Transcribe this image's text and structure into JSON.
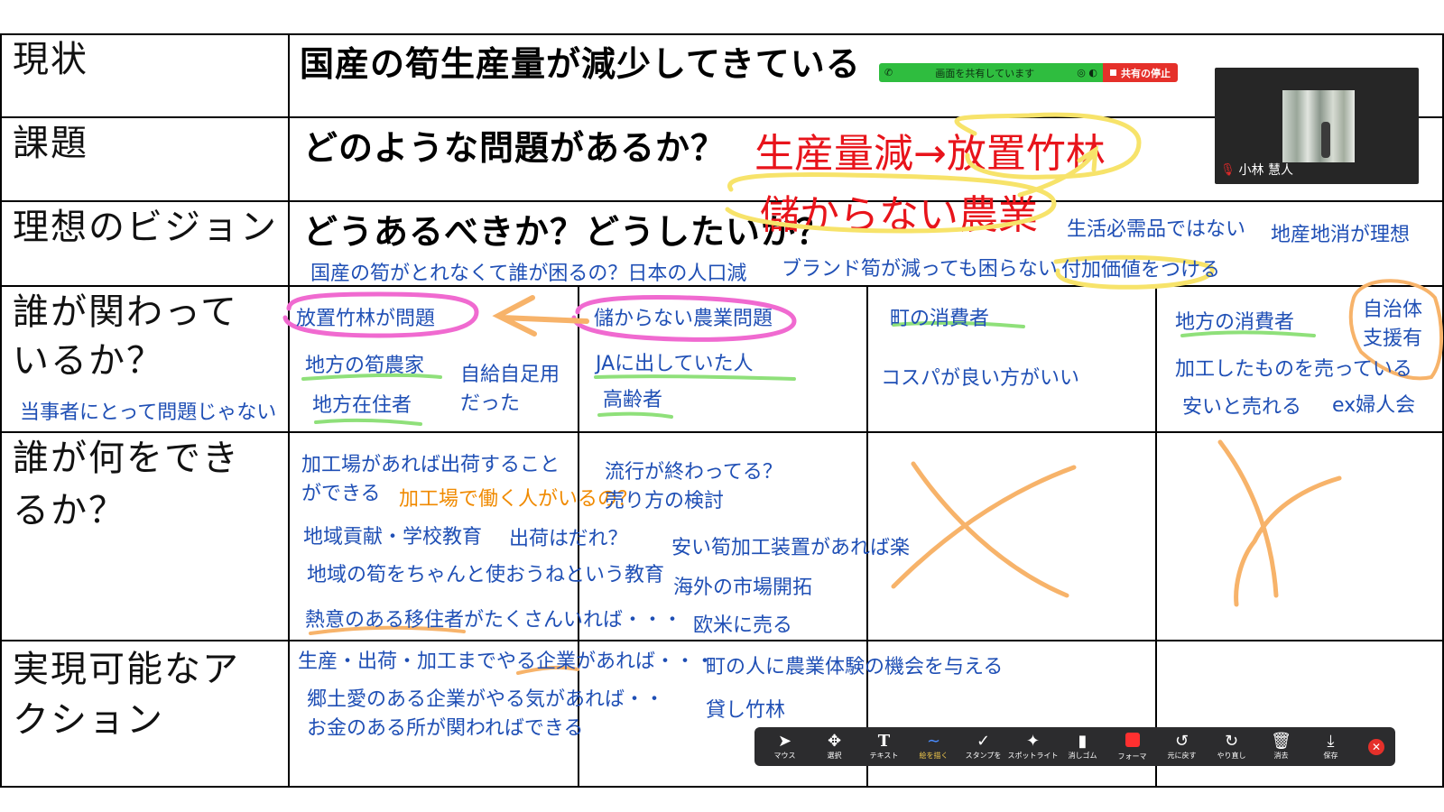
{
  "rows": {
    "r1_label": "現状",
    "r2_label": "課題",
    "r3_label": "理想のビジョン",
    "r4_label_1": "誰が関わって",
    "r4_label_2": "いるか？",
    "r5_label_1": "誰が何をでき",
    "r5_label_2": "るか？",
    "r6_label_1": "実現可能なア",
    "r6_label_2": "クション"
  },
  "headings": {
    "r1": "国産の筍生産量が減少してきている",
    "r2": "どのような問題があるか？",
    "r3": "どうあるべきか？どうしたいか？"
  },
  "red_notes": {
    "a": "生産量減→放置竹林",
    "b": "儲からない農業"
  },
  "notes": {
    "n01": "生活必需品ではない",
    "n02": "地産地消が理想",
    "n03": "国産の筍がとれなくて誰が困るの？日本の人口減",
    "n04": "ブランド筍が減っても困らない",
    "n05": "付加価値をつける",
    "n06": "当事者にとって問題じゃない",
    "n07": "放置竹林が問題",
    "n08": "地方の筍農家",
    "n09": "地方在住者",
    "n10": "自給自足用",
    "n11": "だった",
    "n12": "儲からない農業問題",
    "n13": "JAに出していた人",
    "n14": "高齢者",
    "n15": "町の消費者",
    "n16": "コスパが良い方がいい",
    "n17": "地方の消費者",
    "n18": "自治体",
    "n19": "支援有",
    "n20": "加工したものを売っている",
    "n21": "安いと売れる",
    "n22": "ex婦人会",
    "n23": "加工場があれば出荷すること",
    "n24": "ができる",
    "n25": "加工場で働く人がいるの？",
    "n26": "流行が終わってる？",
    "n27": "売り方の検討",
    "n28": "地域貢献・学校教育",
    "n29": "出荷はだれ？",
    "n30": "安い筍加工装置があれば楽",
    "n31": "地域の筍をちゃんと使おうねという教育",
    "n32": "海外の市場開拓",
    "n33": "熱意のある移住者がたくさんいれば・・・",
    "n34": "欧米に売る",
    "n35": "生産・出荷・加工までやる企業があれば・・・",
    "n36": "町の人に農業体験の機会を与える",
    "n37": "郷土愛のある企業がやる気があれば・・",
    "n38": "貸し竹林",
    "n39": "お金のある所が関わればできる"
  },
  "sharebar": {
    "text": "画面を共有しています",
    "stop": "共有の停止"
  },
  "video": {
    "name": "小林 慧人"
  },
  "toolbar": {
    "mouse": "マウス",
    "select": "選択",
    "text": "テキスト",
    "draw": "絵を描く",
    "stamp": "スタンプを",
    "spotlight": "スポットライト",
    "eraser": "消しゴム",
    "format": "フォーマ",
    "undo": "元に戻す",
    "redo": "やり直し",
    "clear": "消去",
    "save": "保存"
  },
  "colors": {
    "note_blue": "#1f4fb5",
    "note_orange": "#f08a00",
    "heading_red": "#e8141b",
    "highlight_yellow": "#f7e36a",
    "highlight_pink": "#f06ad0",
    "highlight_green": "#8fe07a",
    "highlight_orange": "#f7b36a",
    "share_green": "#2fbd3f",
    "share_red": "#e5302a"
  }
}
